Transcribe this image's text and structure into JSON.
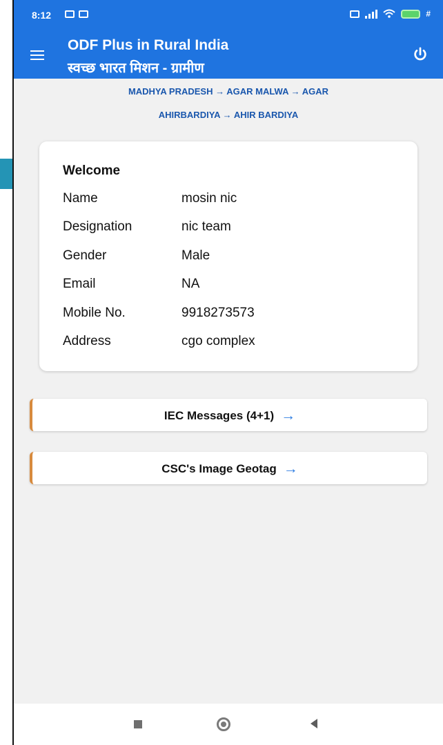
{
  "statusbar": {
    "time": "8:12",
    "right_text": "#"
  },
  "app_bar": {
    "title": "ODF Plus in Rural India",
    "subtitle": "स्वच्छ भारत मिशन - ग्रामीण",
    "menu_icon": "hamburger-menu-icon",
    "power_icon": "power-icon"
  },
  "breadcrumb": {
    "line1": "MADHYA PRADESH → AGAR MALWA → AGAR",
    "line2": "AHIRBARDIYA → AHIR BARDIYA"
  },
  "profile": {
    "heading": "Welcome",
    "rows": [
      {
        "label": "Name",
        "value": "mosin nic"
      },
      {
        "label": "Designation",
        "value": "nic team"
      },
      {
        "label": "Gender",
        "value": "Male"
      },
      {
        "label": "Email",
        "value": "NA"
      },
      {
        "label": "Mobile No.",
        "value": "9918273573"
      },
      {
        "label": "Address",
        "value": "cgo complex"
      }
    ]
  },
  "actions": [
    {
      "label": "IEC Messages (4+1)",
      "arrow": "→"
    },
    {
      "label": "CSC's Image Geotag",
      "arrow": "→"
    }
  ],
  "colors": {
    "app_bar": "#1f74e0",
    "breadcrumb": "#1a57ad",
    "accent_border": "#d78a3d",
    "arrow": "#2f7ee2"
  }
}
